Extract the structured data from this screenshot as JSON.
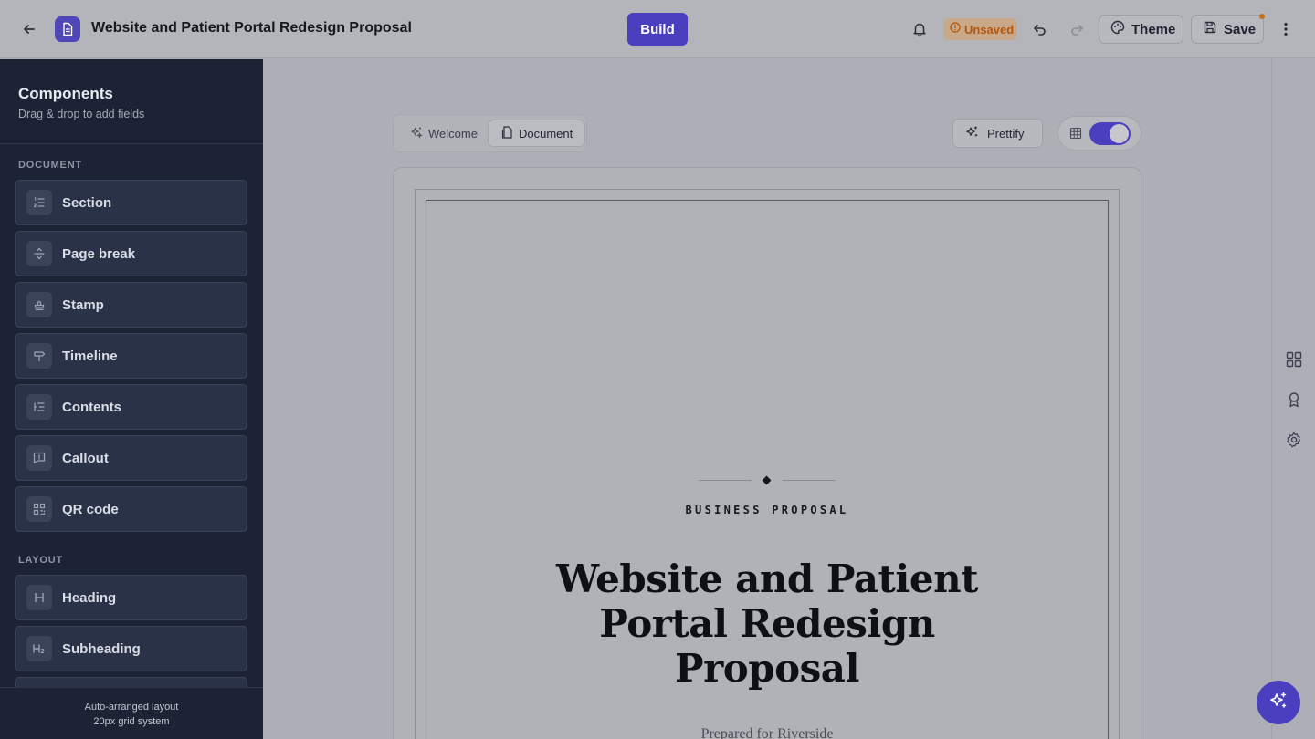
{
  "header": {
    "title": "Website and Patient Portal Redesign Proposal",
    "build_label": "Build",
    "status_label": "Unsaved",
    "theme_label": "Theme",
    "save_label": "Save"
  },
  "sidebar": {
    "title": "Components",
    "subtitle": "Drag & drop to add fields",
    "sections": [
      {
        "label": "DOCUMENT",
        "items": [
          {
            "label": "Section",
            "icon": "list-ordered-icon"
          },
          {
            "label": "Page break",
            "icon": "page-break-icon"
          },
          {
            "label": "Stamp",
            "icon": "stamp-icon"
          },
          {
            "label": "Timeline",
            "icon": "signpost-icon"
          },
          {
            "label": "Contents",
            "icon": "table-of-contents-icon"
          },
          {
            "label": "Callout",
            "icon": "message-alert-icon"
          },
          {
            "label": "QR code",
            "icon": "qr-code-icon"
          }
        ]
      },
      {
        "label": "LAYOUT",
        "items": [
          {
            "label": "Heading",
            "icon": "heading-icon"
          },
          {
            "label": "Subheading",
            "icon": "heading-2-icon"
          }
        ]
      }
    ],
    "footer": {
      "line1": "Auto-arranged layout",
      "line2": "20px grid system"
    }
  },
  "canvas": {
    "tabs": [
      {
        "label": "Welcome",
        "active": false
      },
      {
        "label": "Document",
        "active": true
      }
    ],
    "prettify_label": "Prettify",
    "grid_toggle_on": true
  },
  "document": {
    "kicker": "BUSINESS PROPOSAL",
    "title": "Website and Patient Portal Redesign Proposal",
    "prepared_for": "Prepared for Riverside"
  },
  "colors": {
    "accent": "#4a3fbf",
    "sidebar_bg": "#1c2334",
    "unsaved_text": "#b7560c"
  }
}
